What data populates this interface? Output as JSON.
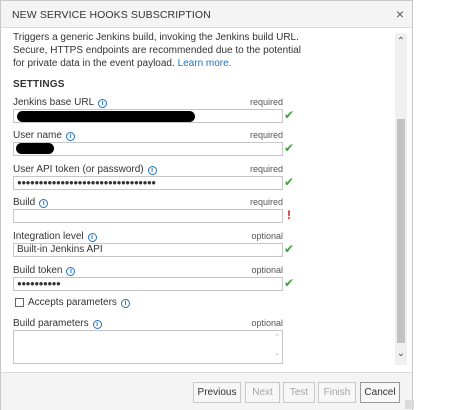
{
  "dialog": {
    "title": "NEW SERVICE HOOKS SUBSCRIPTION",
    "close_label": "×"
  },
  "description": {
    "text": "Triggers a generic Jenkins build, invoking the Jenkins build URL. Secure, HTTPS endpoints are recommended due to the potential for private data in the event payload.",
    "link": "Learn more."
  },
  "settings": {
    "heading": "SETTINGS",
    "jenkins_base_url": {
      "label": "Jenkins base URL",
      "hint": "required",
      "valid": true
    },
    "user_name": {
      "label": "User name",
      "hint": "required",
      "valid": true
    },
    "user_api_token": {
      "label": "User API token (or password)",
      "hint": "required",
      "value": "●●●●●●●●●●●●●●●●●●●●●●●●●●●●●●●●",
      "valid": true
    },
    "build": {
      "label": "Build",
      "hint": "required",
      "value": "",
      "valid": false,
      "error_icon": "!"
    },
    "integration_level": {
      "label": "Integration level",
      "hint": "optional",
      "value": "Built-in Jenkins API",
      "valid": true
    },
    "build_token": {
      "label": "Build token",
      "hint": "optional",
      "value": "●●●●●●●●●●",
      "valid": true
    },
    "accept_parameters": {
      "label": "Accepts parameters",
      "checked": false
    },
    "build_parameters": {
      "label": "Build parameters",
      "hint": "optional",
      "value": ""
    }
  },
  "icons": {
    "info": "i",
    "check": "✔",
    "scroll_up": "⌃",
    "scroll_down": "⌄"
  },
  "footer": {
    "previous": "Previous",
    "next": "Next",
    "test": "Test",
    "finish": "Finish",
    "cancel": "Cancel"
  },
  "colors": {
    "accent": "#1e73be",
    "valid": "#3ba33b",
    "error": "#d42020"
  }
}
